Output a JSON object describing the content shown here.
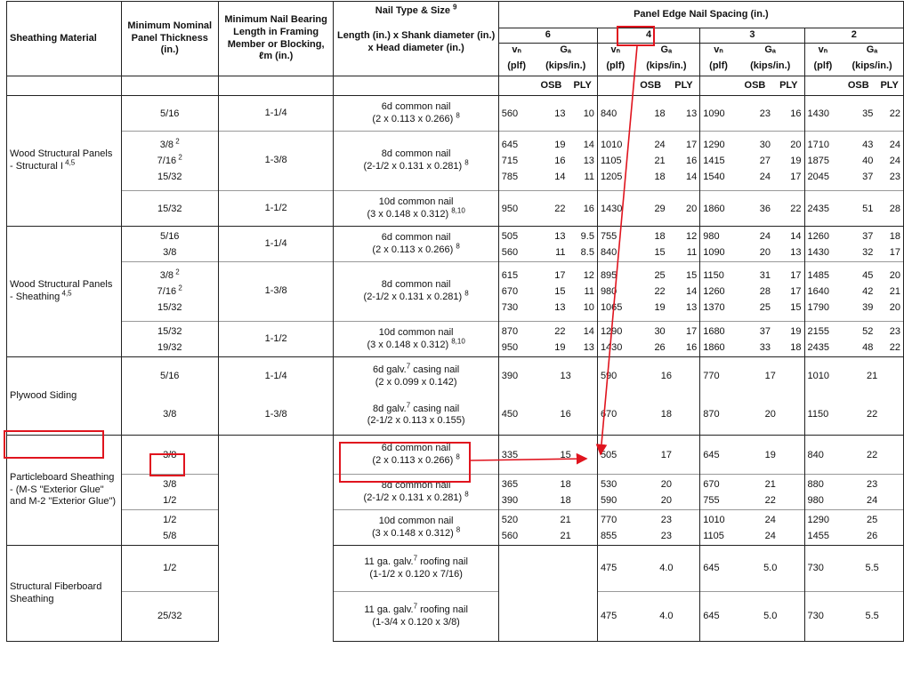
{
  "headers": {
    "sheathing_material": "Sheathing Material",
    "min_thickness": "Minimum Nominal Panel Thickness (in.)",
    "min_nail_bearing": "Minimum Nail Bearing Length in Framing Member or Blocking, ℓm (in.)",
    "nail_type": "Nail Type & Size",
    "nail_type_sup": "9",
    "nail_dims": "Length (in.) x Shank diameter (in.) x Head diameter (in.)",
    "panel_edge": "Panel Edge Nail Spacing (in.)",
    "spacings": [
      "6",
      "4",
      "3",
      "2"
    ],
    "vn": "vₙ",
    "ga": "Gₐ",
    "plf": "(plf)",
    "kips": "(kips/in.)",
    "osb": "OSB",
    "ply": "PLY"
  },
  "materials": {
    "s1": "Wood Structural Panels - Structural I",
    "s1_sup": "4,5",
    "s2": "Wood Structural Panels - Sheathing",
    "s2_sup": "4,5",
    "s3": "Plywood Siding",
    "s4": "Particleboard Sheathing - (M-S \"Exterior Glue\" and M-2 \"Exterior Glue\")",
    "s5": "Structural Fiberboard Sheathing"
  },
  "groups": [
    {
      "thk": [
        "5/16"
      ],
      "thk_sup": [
        ""
      ],
      "bearing": "1-1/4",
      "nail": "6d common nail",
      "dims": "(2 x 0.113 x 0.266)",
      "sup": "8",
      "rows": [
        [
          "560",
          "13",
          "10",
          "840",
          "18",
          "13",
          "1090",
          "23",
          "16",
          "1430",
          "35",
          "22"
        ]
      ]
    },
    {
      "thk": [
        "3/8",
        "7/16",
        "15/32"
      ],
      "thk_sup": [
        "2",
        "2",
        ""
      ],
      "bearing": "1-3/8",
      "nail": "8d common nail",
      "dims": "(2-1/2 x 0.131 x 0.281)",
      "sup": "8",
      "rows": [
        [
          "645",
          "19",
          "14",
          "1010",
          "24",
          "17",
          "1290",
          "30",
          "20",
          "1710",
          "43",
          "24"
        ],
        [
          "715",
          "16",
          "13",
          "1105",
          "21",
          "16",
          "1415",
          "27",
          "19",
          "1875",
          "40",
          "24"
        ],
        [
          "785",
          "14",
          "11",
          "1205",
          "18",
          "14",
          "1540",
          "24",
          "17",
          "2045",
          "37",
          "23"
        ]
      ]
    },
    {
      "thk": [
        "15/32"
      ],
      "thk_sup": [
        ""
      ],
      "bearing": "1-1/2",
      "nail": "10d common nail",
      "dims": "(3 x 0.148 x 0.312)",
      "sup": "8,10",
      "rows": [
        [
          "950",
          "22",
          "16",
          "1430",
          "29",
          "20",
          "1860",
          "36",
          "22",
          "2435",
          "51",
          "28"
        ]
      ]
    },
    {
      "thk": [
        "5/16",
        "3/8"
      ],
      "thk_sup": [
        "",
        ""
      ],
      "bearing": "1-1/4",
      "nail": "6d common nail",
      "dims": "(2 x 0.113 x 0.266)",
      "sup": "8",
      "rows": [
        [
          "505",
          "13",
          "9.5",
          "755",
          "18",
          "12",
          "980",
          "24",
          "14",
          "1260",
          "37",
          "18"
        ],
        [
          "560",
          "11",
          "8.5",
          "840",
          "15",
          "11",
          "1090",
          "20",
          "13",
          "1430",
          "32",
          "17"
        ]
      ]
    },
    {
      "thk": [
        "3/8",
        "7/16",
        "15/32"
      ],
      "thk_sup": [
        "2",
        "2",
        ""
      ],
      "bearing": "1-3/8",
      "nail": "8d common nail",
      "dims": "(2-1/2 x 0.131 x  0.281)",
      "sup": "8",
      "rows": [
        [
          "615",
          "17",
          "12",
          "895",
          "25",
          "15",
          "1150",
          "31",
          "17",
          "1485",
          "45",
          "20"
        ],
        [
          "670",
          "15",
          "11",
          "980",
          "22",
          "14",
          "1260",
          "28",
          "17",
          "1640",
          "42",
          "21"
        ],
        [
          "730",
          "13",
          "10",
          "1065",
          "19",
          "13",
          "1370",
          "25",
          "15",
          "1790",
          "39",
          "20"
        ]
      ]
    },
    {
      "thk": [
        "15/32",
        "19/32"
      ],
      "thk_sup": [
        "",
        ""
      ],
      "bearing": "1-1/2",
      "nail": "10d common nail",
      "dims": "(3 x 0.148 x 0.312)",
      "sup": "8,10",
      "rows": [
        [
          "870",
          "22",
          "14",
          "1290",
          "30",
          "17",
          "1680",
          "37",
          "19",
          "2155",
          "52",
          "23"
        ],
        [
          "950",
          "19",
          "13",
          "1430",
          "26",
          "16",
          "1860",
          "33",
          "18",
          "2435",
          "48",
          "22"
        ]
      ]
    }
  ],
  "siding": [
    {
      "thk": "5/16",
      "bearing": "1-1/4",
      "nail_pre": "6d galv.",
      "nail_sup": "7",
      "nail_post": " casing nail",
      "dims": "(2 x 0.099 x 0.142)",
      "vals": [
        "390",
        "13",
        "590",
        "16",
        "770",
        "17",
        "1010",
        "21"
      ]
    },
    {
      "thk": "3/8",
      "bearing": "1-3/8",
      "nail_pre": "8d galv.",
      "nail_sup": "7",
      "nail_post": " casing nail",
      "dims": "(2-1/2 x 0.113 x 0.155)",
      "vals": [
        "450",
        "16",
        "670",
        "18",
        "870",
        "20",
        "1150",
        "22"
      ]
    }
  ],
  "particle": [
    {
      "thk": [
        "3/8"
      ],
      "nail": "6d common nail",
      "dims": "(2 x 0.113 x 0.266)",
      "sup": "8",
      "rows": [
        [
          "335",
          "15",
          "505",
          "17",
          "645",
          "19",
          "840",
          "22"
        ]
      ]
    },
    {
      "thk": [
        "3/8",
        "1/2"
      ],
      "nail": "8d common nail",
      "dims": "(2-1/2 x 0.131 x  0.281)",
      "sup": "8",
      "rows": [
        [
          "365",
          "18",
          "530",
          "20",
          "670",
          "21",
          "880",
          "23"
        ],
        [
          "390",
          "18",
          "590",
          "20",
          "755",
          "22",
          "980",
          "24"
        ]
      ]
    },
    {
      "thk": [
        "1/2",
        "5/8"
      ],
      "nail": "10d common nail",
      "dims": "(3 x 0.148 x 0.312)",
      "sup": "8",
      "rows": [
        [
          "520",
          "21",
          "770",
          "23",
          "1010",
          "24",
          "1290",
          "25"
        ],
        [
          "560",
          "21",
          "855",
          "23",
          "1105",
          "24",
          "1455",
          "26"
        ]
      ]
    }
  ],
  "fiber": [
    {
      "thk": "1/2",
      "nail_pre": "11 ga. galv.",
      "nail_sup": "7",
      "nail_post": " roofing nail",
      "dims": "(1-1/2  x 0.120 x 7/16)",
      "vals": [
        "475",
        "4.0",
        "645",
        "5.0",
        "730",
        "5.5"
      ]
    },
    {
      "thk": "25/32",
      "nail_pre": "11 ga. galv.",
      "nail_sup": "7",
      "nail_post": " roofing nail",
      "dims": "(1-3/4 x 0.120 x 3/8)",
      "vals": [
        "475",
        "4.0",
        "645",
        "5.0",
        "730",
        "5.5"
      ]
    }
  ],
  "highlight_color": "#e0141e"
}
